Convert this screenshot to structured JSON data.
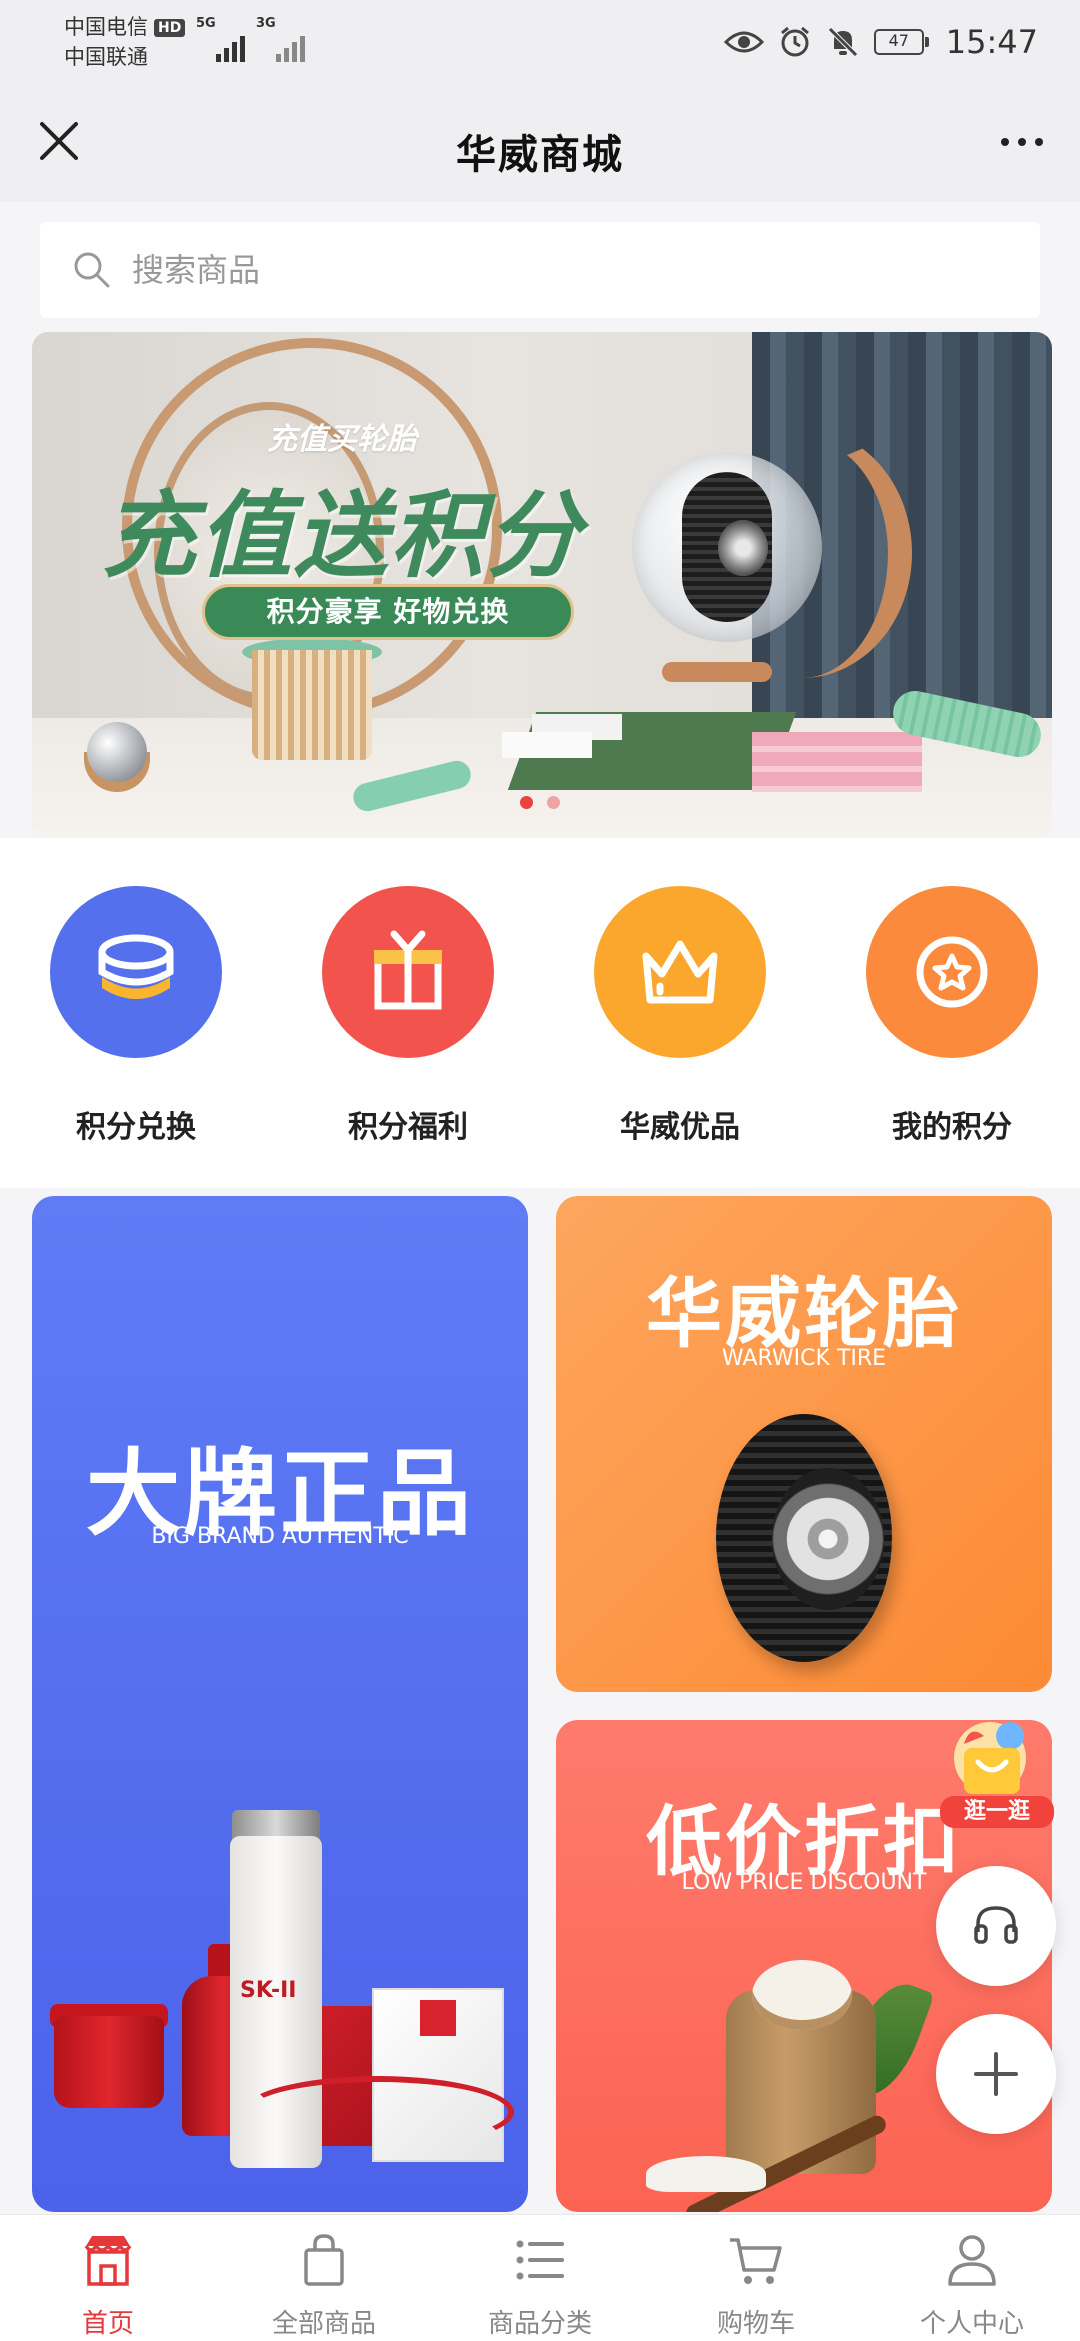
{
  "status_bar": {
    "carrier1": "中国电信",
    "hd_badge": "HD",
    "carrier2": "中国联通",
    "signal1_label": "5G",
    "signal2_label": "3G",
    "battery": "47",
    "time": "15:47"
  },
  "header": {
    "title": "华威商城"
  },
  "search": {
    "placeholder": "搜索商品"
  },
  "banner": {
    "subtitle": "充值买轮胎",
    "title": "充值送积分",
    "pill_text": "积分豪享 好物兑换",
    "slide_count": 2,
    "active_slide": 1
  },
  "quick_actions": [
    {
      "label": "积分兑换",
      "icon": "coins-stack-icon",
      "color": "#5470ec"
    },
    {
      "label": "积分福利",
      "icon": "gift-icon",
      "color": "#f2544d"
    },
    {
      "label": "华威优品",
      "icon": "crown-icon",
      "color": "#fba62c"
    },
    {
      "label": "我的积分",
      "icon": "star-badge-icon",
      "color": "#fb8a3c"
    }
  ],
  "cards": {
    "brand": {
      "title": "大牌正品",
      "subtitle": "BIG BRAND AUTHENTIC",
      "product_text": "SK-II",
      "color": "#5470ec"
    },
    "tire": {
      "title": "华威轮胎",
      "subtitle": "WARWICK TIRE",
      "color": "#fd9a4a"
    },
    "discount": {
      "title": "低价折扣",
      "subtitle": "LOW PRICE DISCOUNT",
      "color": "#fd6f60"
    }
  },
  "floating": {
    "shop_label": "逛一逛"
  },
  "bottom_nav": [
    {
      "label": "首页",
      "active": true
    },
    {
      "label": "全部商品",
      "active": false
    },
    {
      "label": "商品分类",
      "active": false
    },
    {
      "label": "购物车",
      "active": false
    },
    {
      "label": "个人中心",
      "active": false
    }
  ],
  "colors": {
    "accent_red": "#e5383b",
    "nav_inactive": "#888888"
  }
}
